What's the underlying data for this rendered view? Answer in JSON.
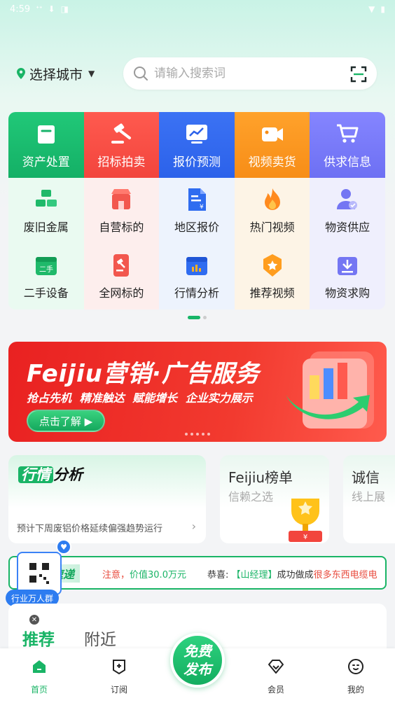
{
  "status_bar": {
    "time": "4:59"
  },
  "header": {
    "city_label": "选择城市",
    "search_placeholder": "请输入搜索词"
  },
  "categories": [
    {
      "head": "资产处置",
      "items": [
        "废旧金属",
        "二手设备"
      ]
    },
    {
      "head": "招标拍卖",
      "items": [
        "自营标的",
        "全网标的"
      ]
    },
    {
      "head": "报价预测",
      "items": [
        "地区报价",
        "行情分析"
      ]
    },
    {
      "head": "视频卖货",
      "items": [
        "热门视频",
        "推荐视频"
      ]
    },
    {
      "head": "供求信息",
      "items": [
        "物资供应",
        "物资求购"
      ]
    }
  ],
  "icons": {
    "asset": "bag-icon",
    "bid": "gavel-icon",
    "price": "chart-icon",
    "video": "camera-icon",
    "supply": "cart-icon",
    "metal": "gold-bars-icon",
    "used": "calendar-used-icon",
    "self": "shop-icon",
    "allnet": "phone-gavel-icon",
    "region": "document-yen-icon",
    "trend": "calendar-chart-icon",
    "hot": "flame-icon",
    "recommend": "medal-icon",
    "provide": "user-check-icon",
    "demand": "download-box-icon"
  },
  "colors": {
    "brand": "#19b466",
    "red": "#f2453d",
    "blue": "#2c62ea",
    "orange": "#f78d17",
    "purple": "#6d70f3"
  },
  "banner": {
    "title": "Feijiu营销·广告服务",
    "subtitle": "抢占先机 精准触达 赋能增长 企业实力展示",
    "button": "点击了解 ▶"
  },
  "trend_card": {
    "title_a": "行情",
    "title_b": "分析",
    "desc": "预计下周废铝价格延续偏强趋势运行"
  },
  "rank_card": {
    "title": "Feijiu榜单",
    "sub": "信赖之选"
  },
  "credit_card": {
    "title": "诚信",
    "sub": "线上展"
  },
  "ticker": {
    "tag": "速递",
    "t1_a": "注意，",
    "t1_value": "价值30.0万元",
    "t2_prefix": "恭喜:",
    "t2_name": "【山经理】",
    "t2_mid": "成功做成",
    "t2_product": "很多东西电缆电"
  },
  "group": {
    "label": "行业万人群"
  },
  "feed": {
    "tab1": "推荐",
    "tab2": "附近"
  },
  "nav": {
    "home": "首页",
    "subscribe": "订阅",
    "publish": "免费\n发布",
    "member": "会员",
    "mine": "我的"
  }
}
